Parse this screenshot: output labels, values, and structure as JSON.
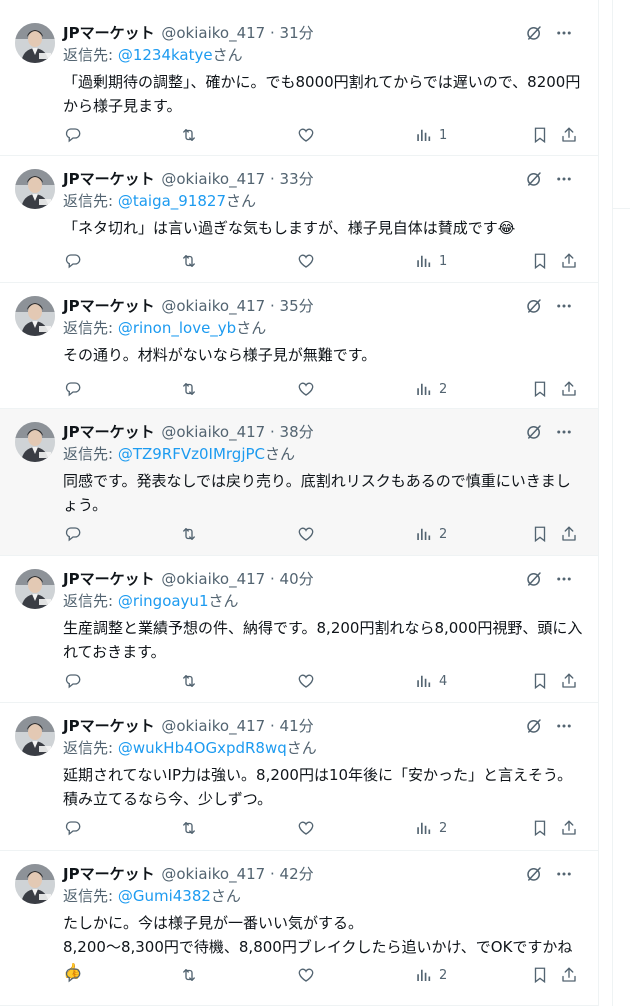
{
  "account": {
    "name": "JPマーケット",
    "handle": "@okiaiko_417",
    "reply_prefix": "返信先: ",
    "reply_suffix": "さん"
  },
  "colors": {
    "link": "#1d9bf0",
    "muted": "#536471",
    "text": "#0f1419",
    "highlight_bg": "#f7f7f7"
  },
  "icons": [
    "more-icon",
    "grok-icon",
    "reply-icon",
    "retweet-icon",
    "like-icon",
    "views-icon",
    "bookmark-icon",
    "share-icon"
  ],
  "tweets": [
    {
      "time": "31分",
      "reply_to": "@1234katye",
      "text": "「過剰期待の調整」、確かに。でも8000円割れてからでは遅いので、8200円\nから様子見ます。",
      "views": "1"
    },
    {
      "time": "33分",
      "reply_to": "@taiga_91827",
      "text": "「ネタ切れ」は言い過ぎな気もしますが、様子見自体は賛成です😂",
      "views": "1"
    },
    {
      "time": "35分",
      "reply_to": "@rinon_love_yb",
      "text": "その通り。材料がないなら様子見が無難です。",
      "views": "2"
    },
    {
      "time": "38分",
      "reply_to": "@TZ9RFVz0IMrgjPC",
      "text": "同感です。発表なしでは戻り売り。底割れリスクもあるので慎重にいきまし\nょう。",
      "views": "2"
    },
    {
      "time": "40分",
      "reply_to": "@ringoayu1",
      "text": "生産調整と業績予想の件、納得です。8,200円割れなら8,000円視野、頭に入\nれておきます。",
      "views": "4"
    },
    {
      "time": "41分",
      "reply_to": "@wukHb4OGxpdR8wq",
      "text": "延期されてないIP力は強い。8,200円は10年後に「安かった」と言えそう。\n積み立てるなら今、少しずつ。",
      "views": "2"
    },
    {
      "time": "42分",
      "reply_to": "@Gumi4382",
      "text": "たしかに。今は様子見が一番いい気がする。\n8,200～8,300円で待機、8,800円ブレイクしたら追いかけ、でOKですかね👍",
      "views": "2"
    }
  ]
}
